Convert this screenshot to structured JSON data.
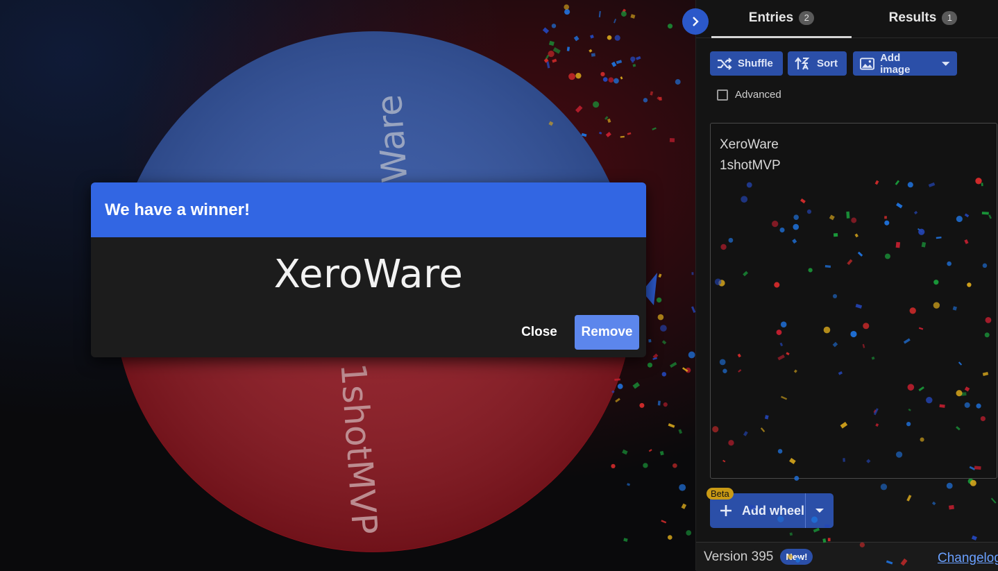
{
  "wheel": {
    "slices": [
      {
        "label": "XeroWare",
        "color": "#2c4fa0"
      },
      {
        "label": "1shotMVP",
        "color": "#8c111b"
      }
    ]
  },
  "panel": {
    "tabs": [
      {
        "label": "Entries",
        "count": "2"
      },
      {
        "label": "Results",
        "count": "1"
      }
    ],
    "toolbar": {
      "shuffle_label": "Shuffle",
      "sort_label": "Sort",
      "add_image_label": "Add image"
    },
    "advanced_label": "Advanced",
    "entries": [
      "XeroWare",
      "1shotMVP"
    ],
    "add_wheel": {
      "label": "Add wheel",
      "badge": "Beta"
    },
    "footer": {
      "version": "Version 395",
      "new_badge": "New!",
      "changelog": "Changelog"
    }
  },
  "dialog": {
    "title": "We have a winner!",
    "winner": "XeroWare",
    "close_label": "Close",
    "remove_label": "Remove"
  },
  "colors": {
    "accent": "#3266e3",
    "button": "#2b4fa8",
    "remove_button": "#5c86ec",
    "beta_badge": "#c99a15"
  }
}
